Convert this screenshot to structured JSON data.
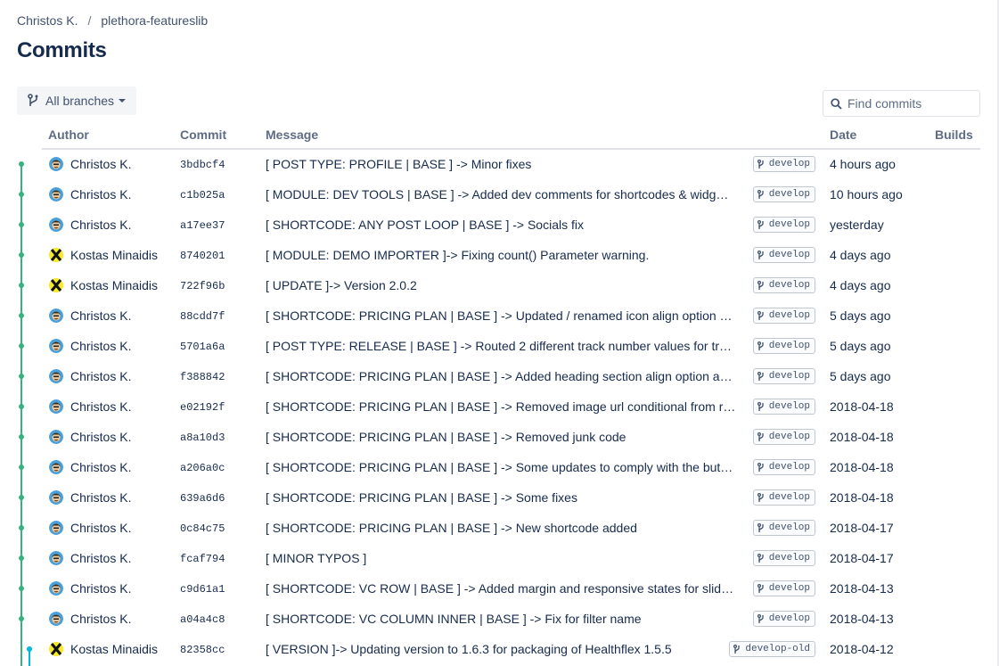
{
  "breadcrumb": {
    "owner": "Christos K.",
    "separator": "/",
    "repo": "plethora-featureslib"
  },
  "page_title": "Commits",
  "branch_filter": {
    "label": "All branches"
  },
  "search": {
    "placeholder": "Find commits"
  },
  "columns": {
    "author": "Author",
    "commit": "Commit",
    "message": "Message",
    "date": "Date",
    "builds": "Builds"
  },
  "colors": {
    "graph_green": "#36b37e",
    "graph_teal": "#00b8d9"
  },
  "commits": [
    {
      "author": "Christos K.",
      "avatar": "ck",
      "hash": "3bdbcf4",
      "message": "[ POST TYPE: PROFILE | BASE ] -> Minor fixes",
      "branch": "develop",
      "date": "4 hours ago"
    },
    {
      "author": "Christos K.",
      "avatar": "ck",
      "hash": "c1b025a",
      "message": "[ MODULE: DEV TOOLS | BASE ] -> Added dev comments for shortcodes & widg…",
      "branch": "develop",
      "date": "10 hours ago"
    },
    {
      "author": "Christos K.",
      "avatar": "ck",
      "hash": "a17ee37",
      "message": "[ SHORTCODE: ANY POST LOOP | BASE ] -> Socials fix",
      "branch": "develop",
      "date": "yesterday"
    },
    {
      "author": "Kostas Minaidis",
      "avatar": "km",
      "hash": "8740201",
      "message": "[ MODULE: DEMO IMPORTER ]-> Fixing count() Parameter warning.",
      "branch": "develop",
      "date": "4 days ago"
    },
    {
      "author": "Kostas Minaidis",
      "avatar": "km",
      "hash": "722f96b",
      "message": "[ UPDATE ]-> Version 2.0.2",
      "branch": "develop",
      "date": "4 days ago"
    },
    {
      "author": "Christos K.",
      "avatar": "ck",
      "hash": "88cdd7f",
      "message": "[ SHORTCODE: PRICING PLAN | BASE ] -> Updated / renamed icon align option …",
      "branch": "develop",
      "date": "5 days ago"
    },
    {
      "author": "Christos K.",
      "avatar": "ck",
      "hash": "5701a6a",
      "message": "[ POST TYPE: RELEASE | BASE ] -> Routed 2 different track number values for tr…",
      "branch": "develop",
      "date": "5 days ago"
    },
    {
      "author": "Christos K.",
      "avatar": "ck",
      "hash": "f388842",
      "message": "[ SHORTCODE: PRICING PLAN | BASE ] -> Added heading section align option a…",
      "branch": "develop",
      "date": "5 days ago"
    },
    {
      "author": "Christos K.",
      "avatar": "ck",
      "hash": "e02192f",
      "message": "[ SHORTCODE: PRICING PLAN | BASE ] -> Removed image url conditional from r…",
      "branch": "develop",
      "date": "2018-04-18"
    },
    {
      "author": "Christos K.",
      "avatar": "ck",
      "hash": "a8a10d3",
      "message": "[ SHORTCODE: PRICING PLAN | BASE ] -> Removed junk code",
      "branch": "develop",
      "date": "2018-04-18"
    },
    {
      "author": "Christos K.",
      "avatar": "ck",
      "hash": "a206a0c",
      "message": "[ SHORTCODE: PRICING PLAN | BASE ] -> Some updates to comply with the but…",
      "branch": "develop",
      "date": "2018-04-18"
    },
    {
      "author": "Christos K.",
      "avatar": "ck",
      "hash": "639a6d6",
      "message": "[ SHORTCODE: PRICING PLAN | BASE ] -> Some fixes",
      "branch": "develop",
      "date": "2018-04-18"
    },
    {
      "author": "Christos K.",
      "avatar": "ck",
      "hash": "0c84c75",
      "message": "[ SHORTCODE: PRICING PLAN | BASE ] -> New shortcode added",
      "branch": "develop",
      "date": "2018-04-17"
    },
    {
      "author": "Christos K.",
      "avatar": "ck",
      "hash": "fcaf794",
      "message": "[ MINOR TYPOS ]",
      "branch": "develop",
      "date": "2018-04-17"
    },
    {
      "author": "Christos K.",
      "avatar": "ck",
      "hash": "c9d61a1",
      "message": "[ SHORTCODE: VC ROW | BASE ] -> Added margin and responsive states for slid…",
      "branch": "develop",
      "date": "2018-04-13"
    },
    {
      "author": "Christos K.",
      "avatar": "ck",
      "hash": "a04a4c8",
      "message": "[ SHORTCODE: VC COLUMN INNER | BASE ] -> Fix for filter name",
      "branch": "develop",
      "date": "2018-04-13"
    },
    {
      "author": "Kostas Minaidis",
      "avatar": "km",
      "hash": "82358cc",
      "message": "[ VERSION ]-> Updating version to 1.6.3 for packaging of Healthflex 1.5.5",
      "branch": "develop-old",
      "date": "2018-04-12"
    }
  ]
}
